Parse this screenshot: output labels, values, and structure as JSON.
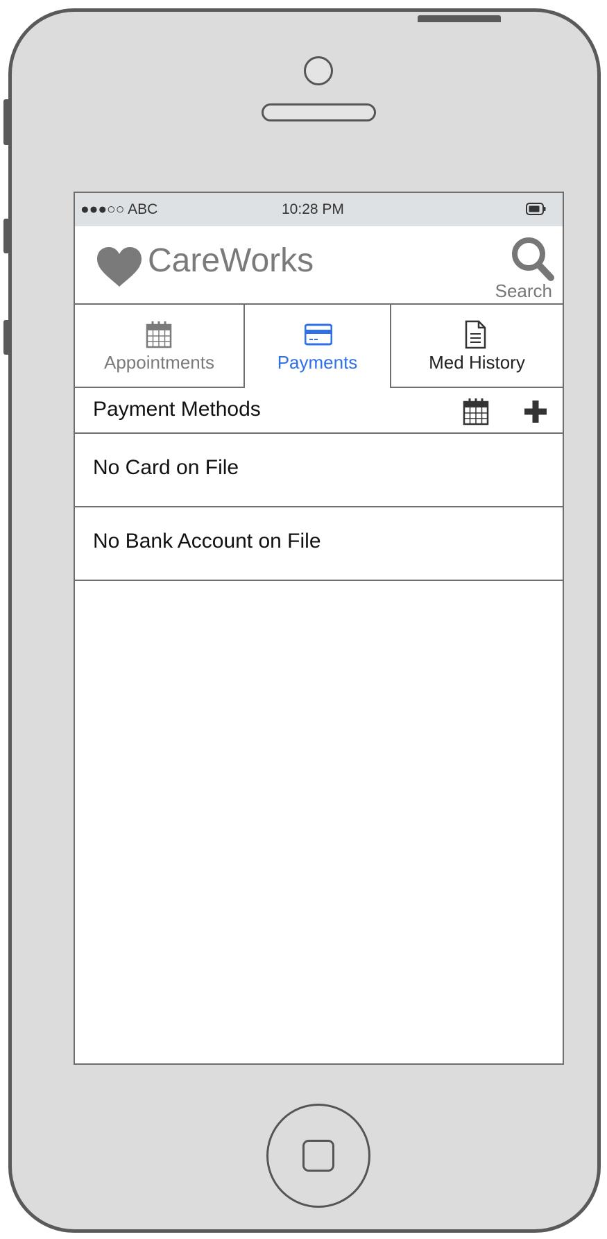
{
  "status_bar": {
    "carrier": "●●●○○ ABC",
    "time": "10:28 PM",
    "battery_icon": "battery-icon"
  },
  "header": {
    "app_name": "CareWorks",
    "logo_icon": "heart-icon",
    "search_label": "Search",
    "search_icon": "search-icon"
  },
  "tabs": [
    {
      "label": "Appointments",
      "icon": "calendar-icon",
      "active": false
    },
    {
      "label": "Payments",
      "icon": "credit-card-icon",
      "active": true
    },
    {
      "label": "Med History",
      "icon": "document-icon",
      "active": false
    }
  ],
  "section": {
    "title": "Payment Methods",
    "actions": [
      "calendar-icon",
      "plus-icon"
    ]
  },
  "items": [
    {
      "label": "No Card on File"
    },
    {
      "label": "No Bank Account on File"
    }
  ],
  "colors": {
    "frame": "#dcdcdc",
    "frame_outline": "#5a5a5a",
    "status_bar": "#dde1e4",
    "accent": "#2f6fe8",
    "inactive_tab": "#7a7a7a",
    "logo": "#7a7a7a"
  }
}
